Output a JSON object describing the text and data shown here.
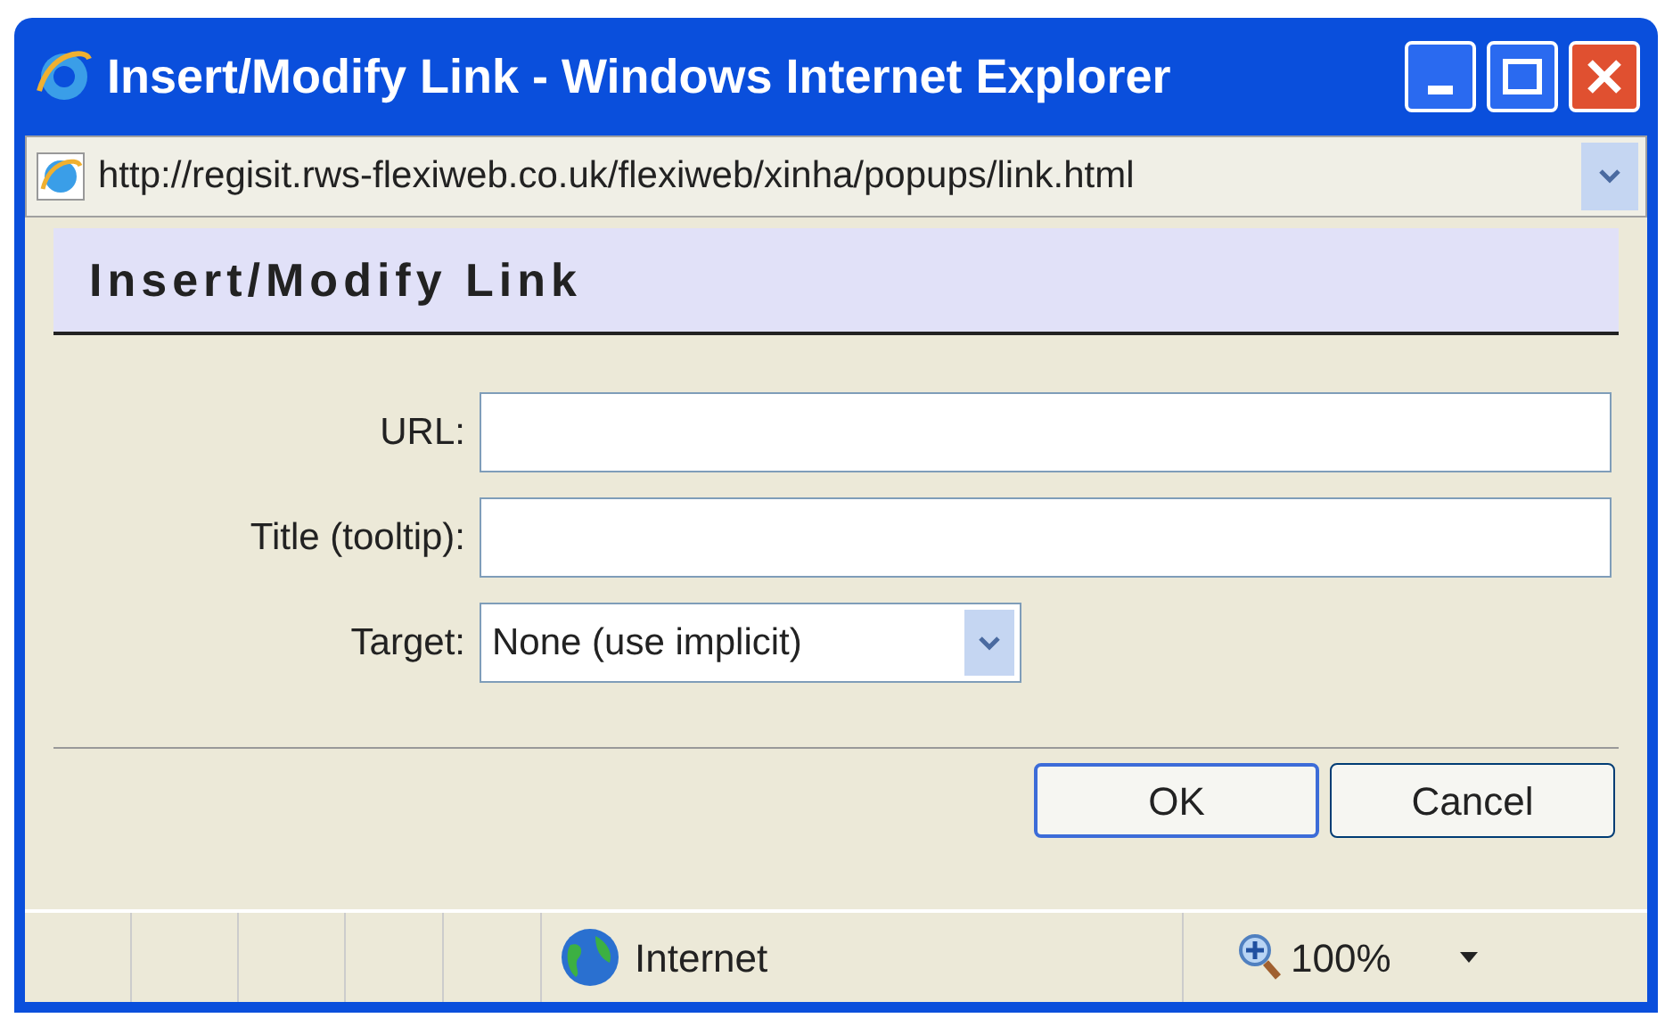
{
  "window": {
    "title": "Insert/Modify Link - Windows Internet Explorer"
  },
  "address_bar": {
    "url": "http://regisit.rws-flexiweb.co.uk/flexiweb/xinha/popups/link.html"
  },
  "dialog": {
    "heading": "Insert/Modify Link",
    "fields": [
      {
        "kind": "text",
        "label": "URL:"
      },
      {
        "kind": "text",
        "label": "Title (tooltip):"
      },
      {
        "kind": "select",
        "label": "Target:",
        "value": "None (use implicit)"
      }
    ],
    "buttons": [
      {
        "label": "OK",
        "default": true
      },
      {
        "label": "Cancel",
        "default": false
      }
    ]
  },
  "status_bar": {
    "zone": "Internet",
    "zoom": "100%"
  }
}
